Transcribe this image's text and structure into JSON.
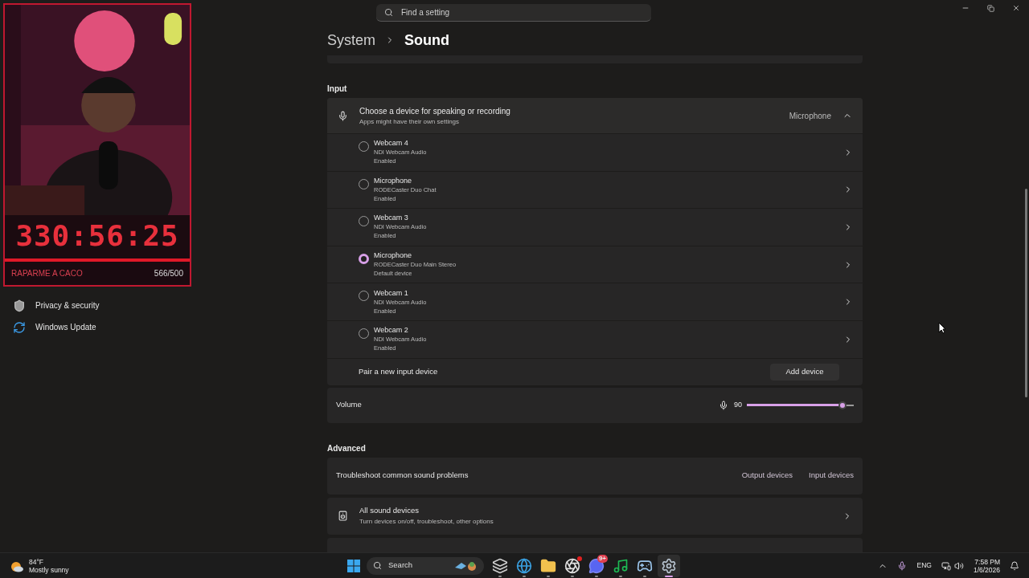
{
  "overlay": {
    "timer": "330:56:25",
    "goal_label": "RAPARME A CACO",
    "goal_count": "566/500"
  },
  "sidebar": {
    "items": [
      {
        "label": "Privacy & security",
        "kind": "shield"
      },
      {
        "label": "Windows Update",
        "kind": "update"
      }
    ]
  },
  "search": {
    "placeholder": "Find a setting"
  },
  "breadcrumb": {
    "parent": "System",
    "current": "Sound"
  },
  "input": {
    "heading": "Input",
    "chooser": {
      "title": "Choose a device for speaking or recording",
      "subtitle": "Apps might have their own settings",
      "value": "Microphone",
      "expanded": true
    },
    "devices": [
      {
        "name": "Webcam 4",
        "detail": "NDI Webcam Audio",
        "status": "Enabled",
        "selected": false
      },
      {
        "name": "Microphone",
        "detail": "RODECaster Duo Chat",
        "status": "Enabled",
        "selected": false
      },
      {
        "name": "Webcam 3",
        "detail": "NDI Webcam Audio",
        "status": "Enabled",
        "selected": false
      },
      {
        "name": "Microphone",
        "detail": "RODECaster Duo Main Stereo",
        "status": "Default device",
        "selected": true
      },
      {
        "name": "Webcam 1",
        "detail": "NDI Webcam Audio",
        "status": "Enabled",
        "selected": false
      },
      {
        "name": "Webcam 2",
        "detail": "NDI Webcam Audio",
        "status": "Enabled",
        "selected": false
      }
    ],
    "pair": {
      "label": "Pair a new input device",
      "button": "Add device"
    },
    "volume": {
      "label": "Volume",
      "reading": "90",
      "level": 0.9
    }
  },
  "advanced": {
    "heading": "Advanced",
    "troubleshoot": {
      "label": "Troubleshoot common sound problems",
      "links": [
        "Output devices",
        "Input devices"
      ]
    },
    "all_devices": {
      "title": "All sound devices",
      "subtitle": "Turn devices on/off, troubleshoot, other options"
    }
  },
  "taskbar": {
    "weather": {
      "temp": "84°F",
      "condition": "Mostly sunny"
    },
    "search": {
      "placeholder": "Search"
    },
    "apps": [
      {
        "kind": "taskview",
        "selected": false,
        "alert": false
      },
      {
        "kind": "edge",
        "selected": false,
        "alert": false
      },
      {
        "kind": "folder",
        "selected": false,
        "alert": false
      },
      {
        "kind": "obs",
        "selected": false,
        "alert": true
      },
      {
        "kind": "discord",
        "selected": false,
        "alert": false,
        "badge": "9+"
      },
      {
        "kind": "spotify",
        "selected": false,
        "alert": false
      },
      {
        "kind": "steam",
        "selected": false,
        "alert": false
      },
      {
        "kind": "settings",
        "selected": true,
        "alert": false
      }
    ],
    "tray": {
      "language": "ENG",
      "time": "7:58 PM",
      "date": "1/6/2026"
    }
  }
}
